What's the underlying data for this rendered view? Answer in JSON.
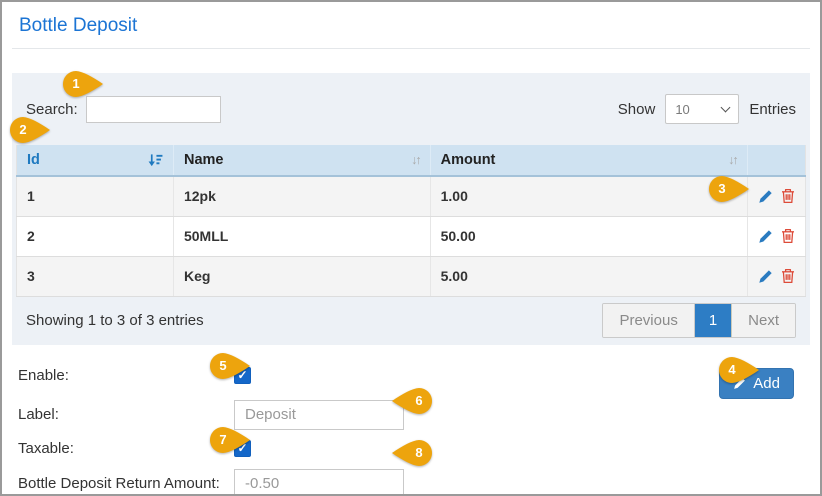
{
  "page": {
    "title": "Bottle Deposit"
  },
  "toolbar": {
    "search_label": "Search:",
    "search_value": "",
    "show_label": "Show",
    "show_value": "10",
    "entries_label": "Entries"
  },
  "table": {
    "columns": [
      {
        "label": "Id",
        "sort_state": "sorted-asc"
      },
      {
        "label": "Name",
        "sort_state": "unsorted"
      },
      {
        "label": "Amount",
        "sort_state": "unsorted"
      },
      {
        "label": ""
      }
    ],
    "rows": [
      {
        "id": "1",
        "name": "12pk",
        "amount": "1.00"
      },
      {
        "id": "2",
        "name": "50MLL",
        "amount": "50.00"
      },
      {
        "id": "3",
        "name": "Keg",
        "amount": "5.00"
      }
    ],
    "row_action_icons": [
      "pencil-edit-icon",
      "trash-delete-icon"
    ],
    "summary": "Showing 1 to 3 of 3 entries",
    "pagination": {
      "previous": "Previous",
      "current": "1",
      "next": "Next"
    }
  },
  "form": {
    "enable_label": "Enable:",
    "enable_checked": true,
    "check_glyph": "✓",
    "label_label": "Label:",
    "label_value": "Deposit",
    "taxable_label": "Taxable:",
    "taxable_checked": true,
    "return_label": "Bottle Deposit Return Amount:",
    "return_value": "-0.50",
    "add_button_label": "Add"
  },
  "callouts": [
    {
      "n": "1"
    },
    {
      "n": "2"
    },
    {
      "n": "3"
    },
    {
      "n": "4"
    },
    {
      "n": "5"
    },
    {
      "n": "6"
    },
    {
      "n": "7"
    },
    {
      "n": "8"
    }
  ],
  "sort_icon_glyph": "↓↑",
  "colors": {
    "title_blue": "#1b74d4",
    "table_header_bg": "#cfe2f1",
    "panel_bg": "#edf1f6",
    "callout_orange": "#eda40d",
    "pagination_active_bg": "#2d7dc5",
    "edit_icon_blue": "#2a7bc0",
    "delete_icon_red": "#dd4b39",
    "add_button_bg": "#3a80c2",
    "checkbox_blue": "#1467c9"
  }
}
